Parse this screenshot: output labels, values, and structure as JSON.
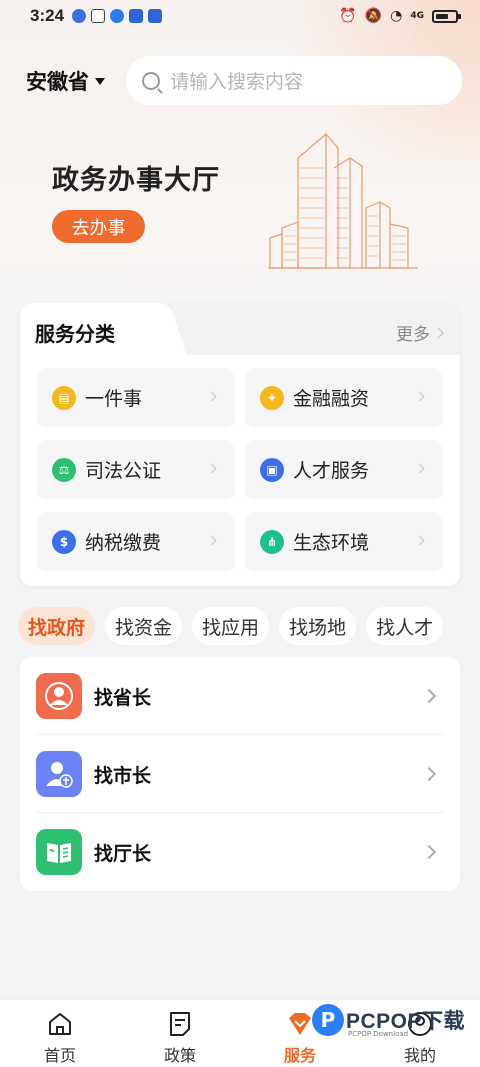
{
  "status_bar": {
    "time": "3:24",
    "network": "4G"
  },
  "header": {
    "province": "安徽省",
    "search_placeholder": "请输入搜索内容"
  },
  "banner": {
    "title": "政务办事大厅",
    "button": "去办事"
  },
  "service_card": {
    "title": "服务分类",
    "more": "更多",
    "items": [
      {
        "label": "一件事",
        "icon": "document-icon",
        "color": "#f5b81c"
      },
      {
        "label": "金融融资",
        "icon": "lightbulb-icon",
        "color": "#f5b81c"
      },
      {
        "label": "司法公证",
        "icon": "gavel-icon",
        "color": "#2fbf71"
      },
      {
        "label": "人才服务",
        "icon": "id-card-icon",
        "color": "#3d6fe6"
      },
      {
        "label": "纳税缴费",
        "icon": "dollar-icon",
        "color": "#3d6fe6"
      },
      {
        "label": "生态环境",
        "icon": "share-icon",
        "color": "#1fbf8f"
      }
    ]
  },
  "find_tabs": [
    "找政府",
    "找资金",
    "找应用",
    "找场地",
    "找人才"
  ],
  "leaders": [
    {
      "label": "找省长",
      "icon": "person-icon",
      "color": "#f06a4b"
    },
    {
      "label": "找市长",
      "icon": "person-badge-icon",
      "color": "#6b82f5"
    },
    {
      "label": "找厅长",
      "icon": "book-icon",
      "color": "#2fbf71"
    }
  ],
  "bottom_nav": [
    {
      "label": "首页",
      "icon": "home-icon"
    },
    {
      "label": "政策",
      "icon": "policy-icon"
    },
    {
      "label": "服务",
      "icon": "service-icon",
      "active": true
    },
    {
      "label": "我的",
      "icon": "profile-icon"
    }
  ],
  "watermark": {
    "logo": "P",
    "text": "PCPOP下载",
    "sub": "PCPOP Download"
  },
  "colors": {
    "accent": "#ef6a2d",
    "active_tab_bg": "#fbe3d6"
  }
}
